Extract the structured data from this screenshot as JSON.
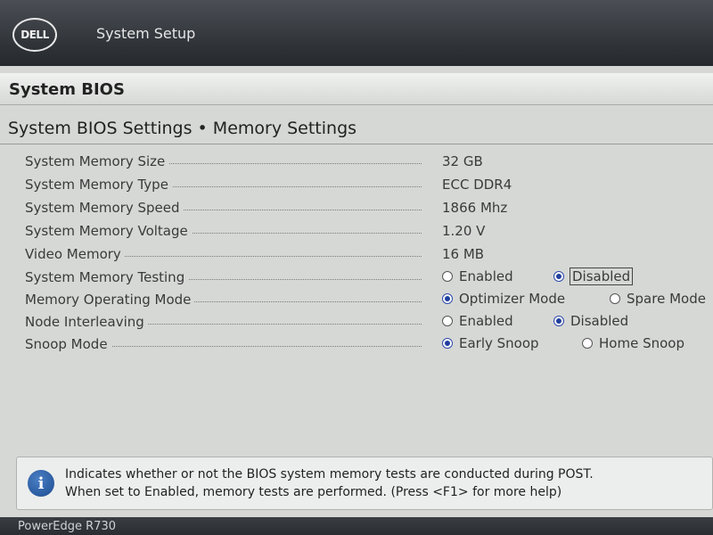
{
  "header": {
    "logo_text": "DELL",
    "app_title": "System Setup"
  },
  "section": {
    "title": "System BIOS"
  },
  "page": {
    "title": "System BIOS Settings • Memory Settings"
  },
  "settings": {
    "memory_size": {
      "label": "System Memory Size",
      "value": "32 GB"
    },
    "memory_type": {
      "label": "System Memory Type",
      "value": "ECC DDR4"
    },
    "memory_speed": {
      "label": "System Memory Speed",
      "value": "1866 Mhz"
    },
    "memory_voltage": {
      "label": "System Memory Voltage",
      "value": "1.20 V"
    },
    "video_memory": {
      "label": "Video Memory",
      "value": "16 MB"
    },
    "memory_testing": {
      "label": "System Memory Testing",
      "options": [
        "Enabled",
        "Disabled"
      ],
      "selected": "Disabled"
    },
    "operating_mode": {
      "label": "Memory Operating Mode",
      "options": [
        "Optimizer Mode",
        "Spare Mode"
      ],
      "selected": "Optimizer Mode"
    },
    "node_interleaving": {
      "label": "Node Interleaving",
      "options": [
        "Enabled",
        "Disabled"
      ],
      "selected": "Disabled"
    },
    "snoop_mode": {
      "label": "Snoop Mode",
      "options": [
        "Early Snoop",
        "Home Snoop"
      ],
      "selected": "Early Snoop"
    }
  },
  "help": {
    "icon": "info-icon",
    "line1": "Indicates whether or not the BIOS system memory tests are conducted during POST.",
    "line2": "When set to Enabled, memory tests are performed. (Press <F1> for more help)"
  },
  "footer": {
    "model": "PowerEdge R730"
  },
  "colors": {
    "background": "#d6d8d6",
    "topbar": "#2f3338",
    "radio_selected": "#1f3f9e",
    "info_icon": "#1d4b8f"
  }
}
